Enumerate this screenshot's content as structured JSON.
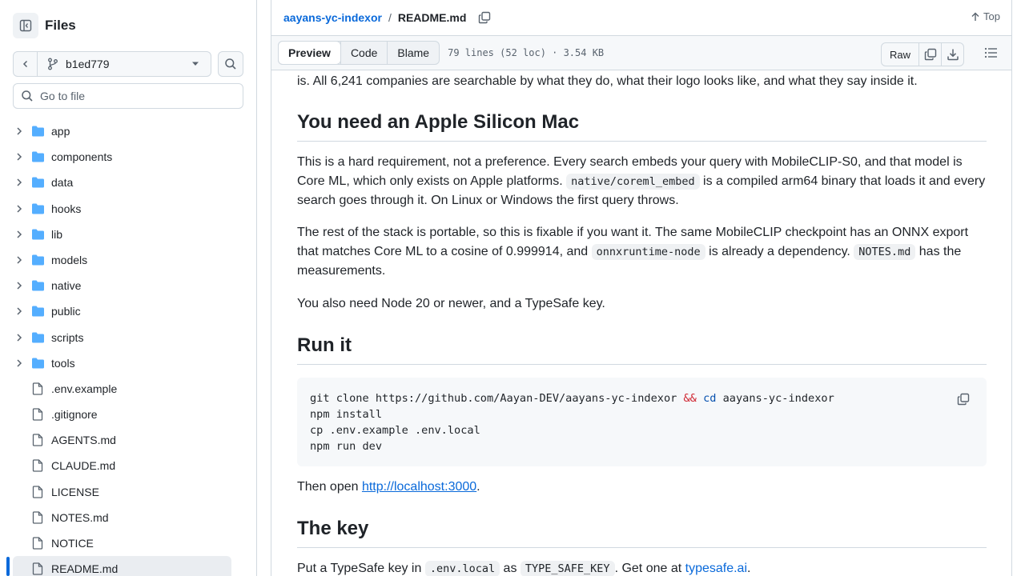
{
  "sidebar": {
    "title": "Files",
    "branch": "b1ed779",
    "goto_placeholder": "Go to file",
    "items": [
      {
        "label": "app",
        "type": "folder"
      },
      {
        "label": "components",
        "type": "folder"
      },
      {
        "label": "data",
        "type": "folder"
      },
      {
        "label": "hooks",
        "type": "folder"
      },
      {
        "label": "lib",
        "type": "folder"
      },
      {
        "label": "models",
        "type": "folder"
      },
      {
        "label": "native",
        "type": "folder"
      },
      {
        "label": "public",
        "type": "folder"
      },
      {
        "label": "scripts",
        "type": "folder"
      },
      {
        "label": "tools",
        "type": "folder"
      },
      {
        "label": ".env.example",
        "type": "file"
      },
      {
        "label": ".gitignore",
        "type": "file"
      },
      {
        "label": "AGENTS.md",
        "type": "file"
      },
      {
        "label": "CLAUDE.md",
        "type": "file"
      },
      {
        "label": "LICENSE",
        "type": "file"
      },
      {
        "label": "NOTES.md",
        "type": "file"
      },
      {
        "label": "NOTICE",
        "type": "file"
      },
      {
        "label": "README.md",
        "type": "file",
        "selected": true
      }
    ]
  },
  "header": {
    "repo": "aayans-yc-indexor",
    "separator": "/",
    "file": "README.md",
    "top_label": "Top"
  },
  "toolbar": {
    "tabs": [
      "Preview",
      "Code",
      "Blame"
    ],
    "active_tab": "Preview",
    "file_info": "79 lines (52 loc) · 3.54 KB",
    "raw_label": "Raw"
  },
  "content": {
    "intro_tail": "is. All 6,241 companies are searchable by what they do, what their logo looks like, and what they say inside it.",
    "h_mac": "You need an Apple Silicon Mac",
    "p1": {
      "a": "This is a hard requirement, not a preference. Every search embeds your query with MobileCLIP-S0, and that model is Core ML, which only exists on Apple platforms. ",
      "code": "native/coreml_embed",
      "b": " is a compiled arm64 binary that loads it and every search goes through it. On Linux or Windows the first query throws."
    },
    "p2": {
      "a": "The rest of the stack is portable, so this is fixable if you want it. The same MobileCLIP checkpoint has an ONNX export that matches Core ML to a cosine of 0.999914, and ",
      "code1": "onnxruntime-node",
      "b": " is already a dependency. ",
      "code2": "NOTES.md",
      "c": " has the measurements."
    },
    "p3": "You also need Node 20 or newer, and a TypeSafe key.",
    "h_run": "Run it",
    "code_lines": {
      "l1_a": "git clone https://github.com/Aayan-DEV/aayans-yc-indexor ",
      "l1_op": "&&",
      "l1_cd": "cd",
      "l1_b": " aayans-yc-indexor",
      "l2": "npm install",
      "l3": "cp .env.example .env.local",
      "l4": "npm run dev"
    },
    "then_open": {
      "a": "Then open ",
      "link": "http://localhost:3000",
      "b": "."
    },
    "h_key": "The key",
    "key_p": {
      "a": "Put a TypeSafe key in ",
      "code1": ".env.local",
      "b": " as ",
      "code2": "TYPE_SAFE_KEY",
      "c": ". Get one at ",
      "link": "typesafe.ai",
      "d": "."
    }
  },
  "colors": {
    "accent": "#0969da",
    "folder": "#54aeff",
    "keyword": "#cf222e",
    "builtin": "#0550ae"
  }
}
